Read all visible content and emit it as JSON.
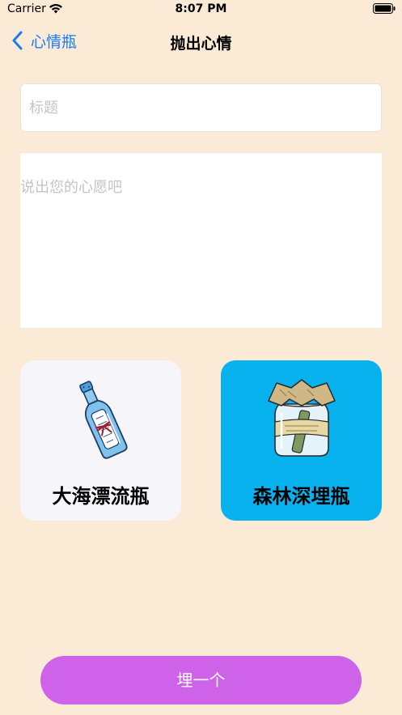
{
  "status_bar": {
    "carrier": "Carrier",
    "time": "8:07 PM",
    "icons": [
      "wifi-icon",
      "battery-icon"
    ]
  },
  "nav": {
    "back_label": "心情瓶",
    "back_icon": "chevron-left-icon",
    "title": "抛出心情"
  },
  "form": {
    "title_placeholder": "标题",
    "title_value": "",
    "wish_placeholder": "说出您的心愿吧",
    "wish_value": ""
  },
  "choices": [
    {
      "label": "大海漂流瓶",
      "icon": "message-bottle-icon",
      "background": "#F5F5FA",
      "selected": false
    },
    {
      "label": "森林深埋瓶",
      "icon": "jar-bottle-icon",
      "background": "#08B2EE",
      "selected": true
    }
  ],
  "action": {
    "label": "埋一个",
    "color": "#CE63EA"
  },
  "colors": {
    "background": "#FBEBD6",
    "accent": "#1A7CF0"
  }
}
